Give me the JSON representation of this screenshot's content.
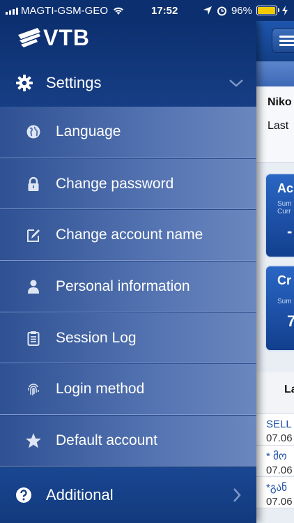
{
  "status_bar": {
    "carrier": "MAGTI-GSM-GEO",
    "time": "17:52",
    "battery_percent": "96%",
    "battery_level": 0.96
  },
  "drawer": {
    "logo_text": "VTB",
    "section_title": "Settings",
    "items": [
      {
        "label": "Language",
        "icon": "globe-icon"
      },
      {
        "label": "Change password",
        "icon": "lock-icon"
      },
      {
        "label": "Change account name",
        "icon": "edit-icon"
      },
      {
        "label": "Personal information",
        "icon": "person-icon"
      },
      {
        "label": "Session Log",
        "icon": "clipboard-icon"
      },
      {
        "label": "Login method",
        "icon": "fingerprint-icon"
      },
      {
        "label": "Default account",
        "icon": "star-icon"
      }
    ],
    "additional_label": "Additional"
  },
  "content": {
    "user_name": "Niko",
    "last_label": "Last",
    "card1": {
      "title": "Ac",
      "sub1": "Sum",
      "sub2": "Curr",
      "value": "-"
    },
    "card2": {
      "title": "Cr",
      "sub1": "Sum",
      "value": "7"
    },
    "tab_label": "La",
    "rows": [
      {
        "title": "SELL",
        "date": "07.06"
      },
      {
        "title": "* მო",
        "date": "07.06"
      },
      {
        "title": "*გან",
        "date": "07.06"
      }
    ]
  },
  "colors": {
    "header_blue": "#0c2f6f",
    "drawer_blue": "#5473b1",
    "battery_yellow": "#f5c900"
  }
}
